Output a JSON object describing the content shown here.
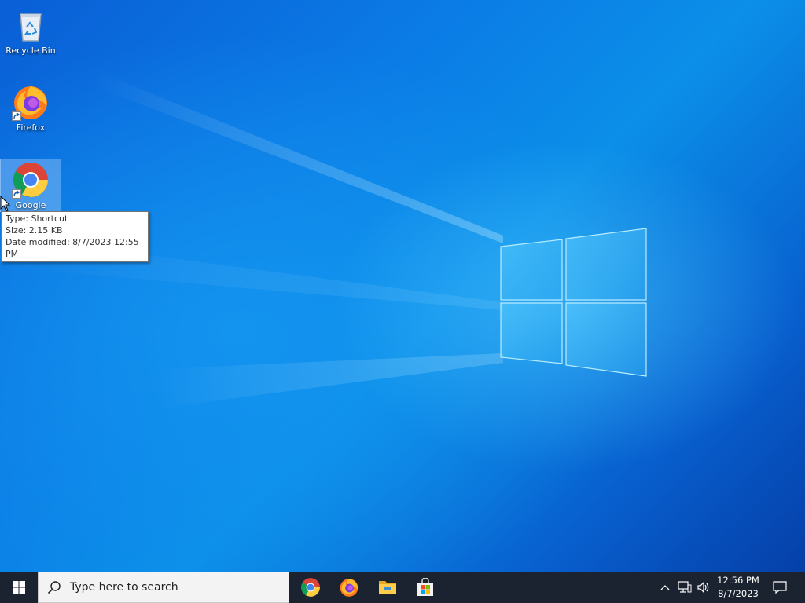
{
  "desktop": {
    "icons": [
      {
        "label": "Recycle Bin",
        "icon": "recycle-bin-icon"
      },
      {
        "label": "Firefox",
        "icon": "firefox-icon",
        "shortcut": true
      },
      {
        "label": "Google",
        "icon": "chrome-icon",
        "shortcut": true,
        "selected": true
      }
    ],
    "tooltip": {
      "line1": "Type: Shortcut",
      "line2": "Size: 2.15 KB",
      "line3": "Date modified: 8/7/2023 12:55 PM"
    }
  },
  "taskbar": {
    "start_icon": "windows-start-icon",
    "search_placeholder": "Type here to search",
    "pinned_apps": [
      "chrome-icon",
      "firefox-icon",
      "file-explorer-icon",
      "microsoft-store-icon"
    ],
    "tray_icons": [
      "chevron-up-icon",
      "network-icon",
      "volume-icon"
    ],
    "clock": {
      "time": "12:56 PM",
      "date": "8/7/2023"
    },
    "notification_icon": "action-center-icon"
  },
  "colors": {
    "taskbar": "#1b2230",
    "desktop_accent": "#0b7de6",
    "tooltip_border": "#767676"
  }
}
